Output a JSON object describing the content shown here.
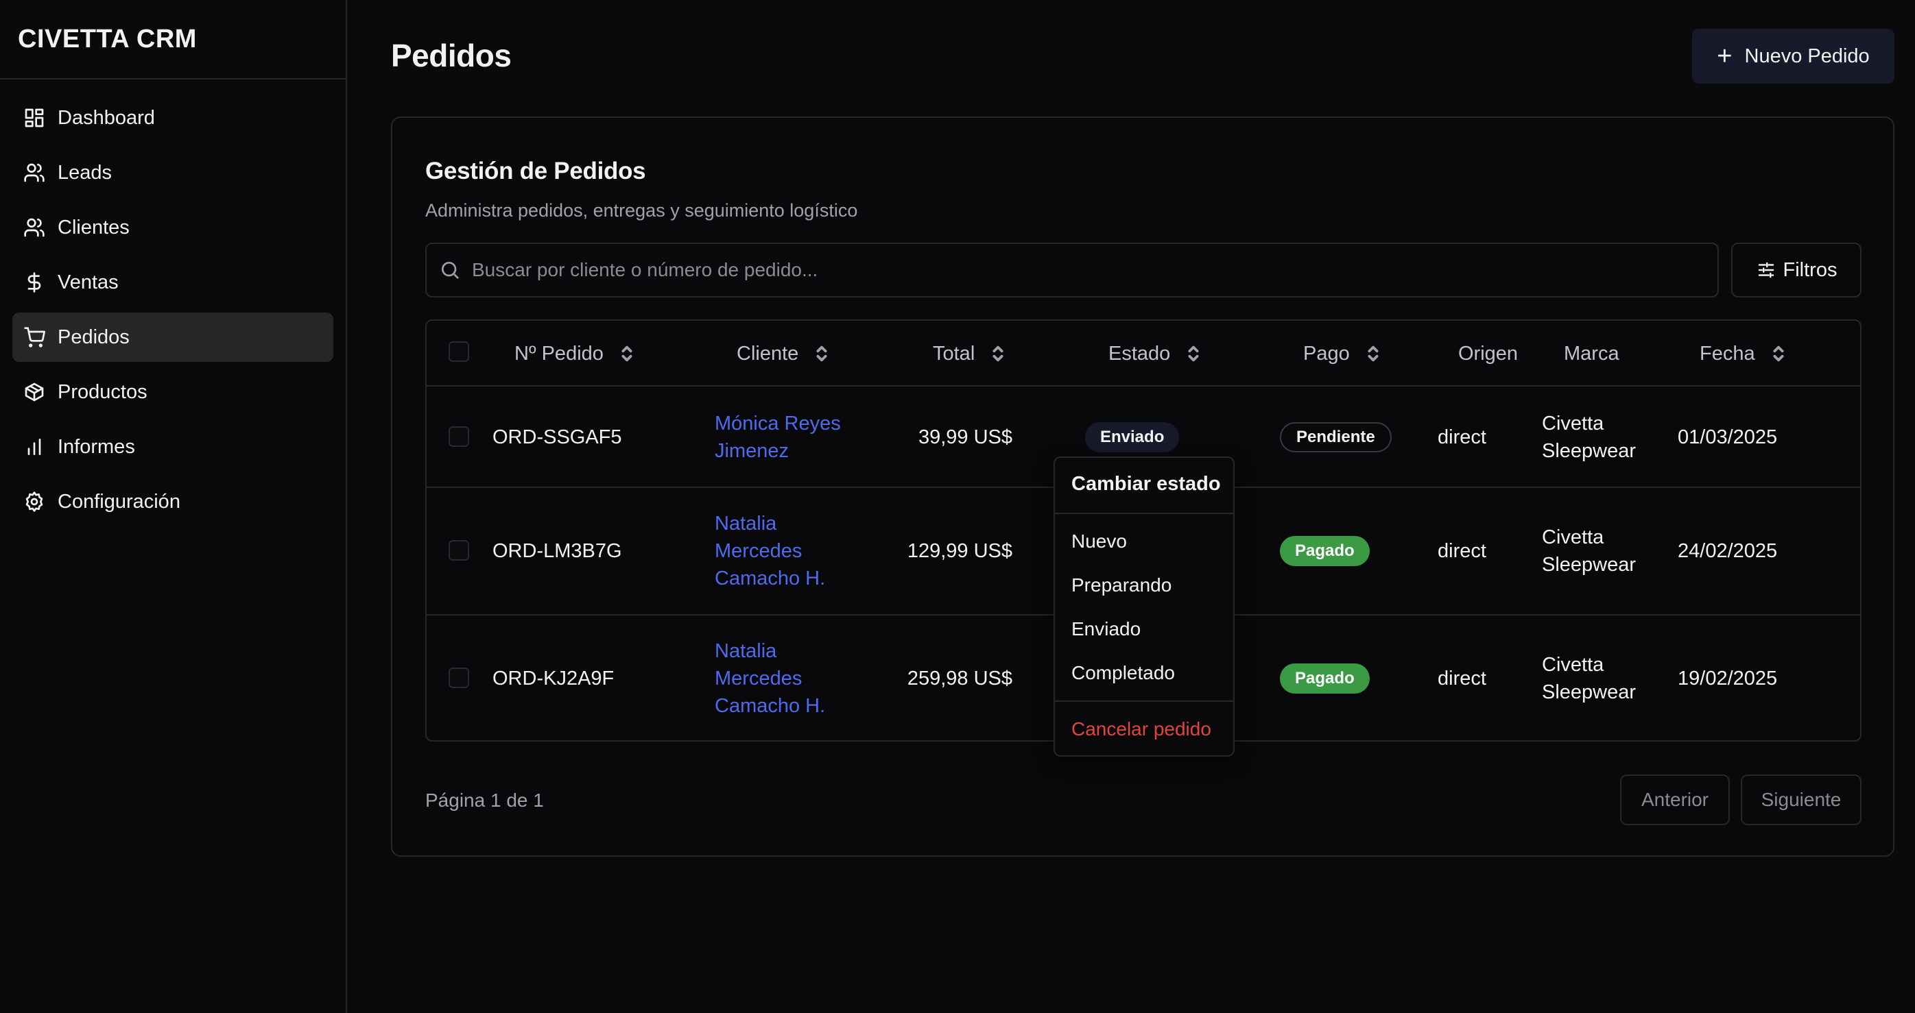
{
  "app": {
    "brand": "CIVETTA CRM"
  },
  "sidebar": {
    "items": [
      {
        "label": "Dashboard",
        "icon": "dashboard-icon"
      },
      {
        "label": "Leads",
        "icon": "users-icon"
      },
      {
        "label": "Clientes",
        "icon": "users-icon"
      },
      {
        "label": "Ventas",
        "icon": "dollar-icon"
      },
      {
        "label": "Pedidos",
        "icon": "cart-icon",
        "active": true
      },
      {
        "label": "Productos",
        "icon": "package-icon"
      },
      {
        "label": "Informes",
        "icon": "bar-chart-icon"
      },
      {
        "label": "Configuración",
        "icon": "gear-icon"
      }
    ]
  },
  "header": {
    "title": "Pedidos",
    "new_button": "Nuevo Pedido"
  },
  "card": {
    "title": "Gestión de Pedidos",
    "subtitle": "Administra pedidos, entregas y seguimiento logístico",
    "search_placeholder": "Buscar por cliente o número de pedido...",
    "filters_label": "Filtros"
  },
  "table": {
    "columns": [
      "Nº Pedido",
      "Cliente",
      "Total",
      "Estado",
      "Pago",
      "Origen",
      "Marca",
      "Fecha"
    ],
    "rows": [
      {
        "id": "ORD-SSGAF5",
        "client": [
          "Mónica Reyes",
          "Jimenez"
        ],
        "total": "39,99 US$",
        "status": "Enviado",
        "payment": "Pendiente",
        "origin": "direct",
        "brand": [
          "Civetta",
          "Sleepwear"
        ],
        "date": "01/03/2025"
      },
      {
        "id": "ORD-LM3B7G",
        "client": [
          "Natalia",
          "Mercedes",
          "Camacho H."
        ],
        "total": "129,99 US$",
        "status": "",
        "payment": "Pagado",
        "origin": "direct",
        "brand": [
          "Civetta",
          "Sleepwear"
        ],
        "date": "24/02/2025"
      },
      {
        "id": "ORD-KJ2A9F",
        "client": [
          "Natalia",
          "Mercedes",
          "Camacho H."
        ],
        "total": "259,98 US$",
        "status": "",
        "payment": "Pagado",
        "origin": "direct",
        "brand": [
          "Civetta",
          "Sleepwear"
        ],
        "date": "19/02/2025"
      }
    ]
  },
  "pagination": {
    "info": "Página 1 de 1",
    "prev": "Anterior",
    "next": "Siguiente"
  },
  "dropdown": {
    "title": "Cambiar estado",
    "options": [
      "Nuevo",
      "Preparando",
      "Enviado",
      "Completado"
    ],
    "cancel": "Cancelar pedido"
  },
  "colors": {
    "background": "#0a0a0c",
    "link": "#4f6bed",
    "paid": "#3b9a44",
    "danger": "#e0463c",
    "primary_button": "#161a2b"
  }
}
